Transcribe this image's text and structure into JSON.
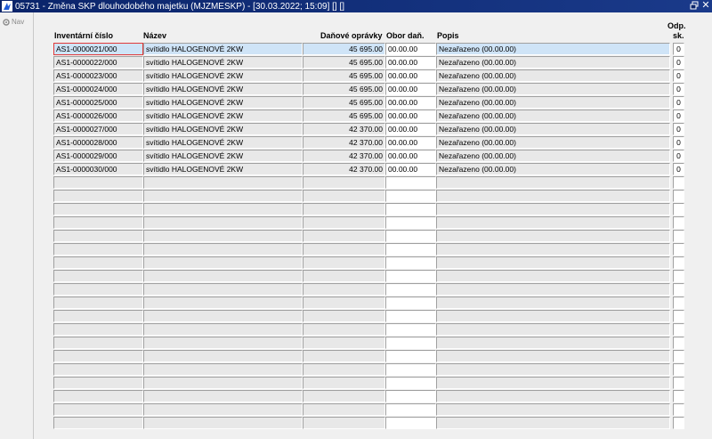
{
  "window": {
    "title": "05731 - Změna SKP dlouhodobého majetku (MJZMESKP) - [30.03.2022; 15:09]  [] []",
    "restore_icon": "restore-icon",
    "close_label": "✕"
  },
  "nav": {
    "label": "Nav",
    "icon": "gear-icon"
  },
  "headers": {
    "inventarni_cislo": "Inventární číslo",
    "nazev": "Název",
    "danove_opravky": "Daňové oprávky",
    "obor_dan": "Obor daň.",
    "popis": "Popis",
    "odp_line1": "Odp.",
    "odp_line2": "sk."
  },
  "rows": [
    {
      "inv": "AS1-0000021/000",
      "nazev": "svítidlo HALOGENOVÉ 2KW",
      "dan": "45 695.00",
      "obor": "00.00.00",
      "popis": "Nezařazeno (00.00.00)",
      "odp": "0"
    },
    {
      "inv": "AS1-0000022/000",
      "nazev": "svítidlo HALOGENOVÉ 2KW",
      "dan": "45 695.00",
      "obor": "00.00.00",
      "popis": "Nezařazeno (00.00.00)",
      "odp": "0"
    },
    {
      "inv": "AS1-0000023/000",
      "nazev": "svítidlo HALOGENOVÉ 2KW",
      "dan": "45 695.00",
      "obor": "00.00.00",
      "popis": "Nezařazeno (00.00.00)",
      "odp": "0"
    },
    {
      "inv": "AS1-0000024/000",
      "nazev": "svítidlo HALOGENOVÉ 2KW",
      "dan": "45 695.00",
      "obor": "00.00.00",
      "popis": "Nezařazeno (00.00.00)",
      "odp": "0"
    },
    {
      "inv": "AS1-0000025/000",
      "nazev": "svítidlo HALOGENOVÉ 2KW",
      "dan": "45 695.00",
      "obor": "00.00.00",
      "popis": "Nezařazeno (00.00.00)",
      "odp": "0"
    },
    {
      "inv": "AS1-0000026/000",
      "nazev": "svítidlo HALOGENOVÉ 2KW",
      "dan": "45 695.00",
      "obor": "00.00.00",
      "popis": "Nezařazeno (00.00.00)",
      "odp": "0"
    },
    {
      "inv": "AS1-0000027/000",
      "nazev": "svítidlo HALOGENOVÉ 2KW",
      "dan": "42 370.00",
      "obor": "00.00.00",
      "popis": "Nezařazeno (00.00.00)",
      "odp": "0"
    },
    {
      "inv": "AS1-0000028/000",
      "nazev": "svítidlo HALOGENOVÉ 2KW",
      "dan": "42 370.00",
      "obor": "00.00.00",
      "popis": "Nezařazeno (00.00.00)",
      "odp": "0"
    },
    {
      "inv": "AS1-0000029/000",
      "nazev": "svítidlo HALOGENOVÉ 2KW",
      "dan": "42 370.00",
      "obor": "00.00.00",
      "popis": "Nezařazeno (00.00.00)",
      "odp": "0"
    },
    {
      "inv": "AS1-0000030/000",
      "nazev": "svítidlo HALOGENOVÉ 2KW",
      "dan": "42 370.00",
      "obor": "00.00.00",
      "popis": "Nezařazeno (00.00.00)",
      "odp": "0"
    }
  ],
  "selected_row": 1,
  "empty_rows": 19,
  "colors": {
    "titlebar": "#0a246a",
    "selected_row": "#cfe4f7",
    "focus_border": "#e03a3a",
    "panel": "#f0f0f0"
  }
}
